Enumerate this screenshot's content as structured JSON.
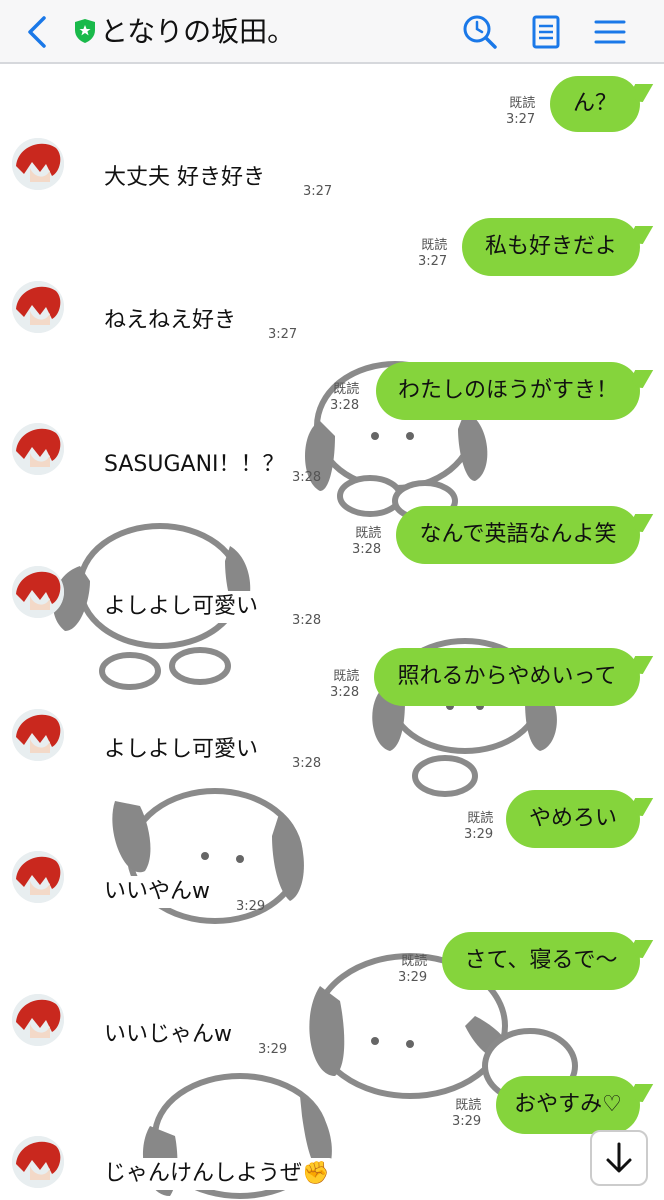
{
  "header": {
    "title": "となりの坂田。",
    "icons": [
      "back-icon",
      "shield-icon",
      "search-icon",
      "notes-icon",
      "menu-icon"
    ],
    "accent_color": "#1a78e8",
    "shield_color": "#19b94a"
  },
  "chat": {
    "bubble_color": "#85d43c",
    "messages": [
      {
        "side": "out",
        "text": "ん？",
        "read": "既読",
        "time": "3:27"
      },
      {
        "side": "in",
        "text": "大丈夫 好き好き",
        "time": "3:27"
      },
      {
        "side": "out",
        "text": "私も好きだよ",
        "read": "既読",
        "time": "3:27"
      },
      {
        "side": "in",
        "text": "ねえねえ好き",
        "time": "3:27"
      },
      {
        "side": "out",
        "text": "わたしのほうがすき！",
        "read": "既読",
        "time": "3:28"
      },
      {
        "side": "in",
        "text": "SASUGANI！！？",
        "time": "3:28"
      },
      {
        "side": "out",
        "text": "なんで英語なんよ笑",
        "read": "既読",
        "time": "3:28"
      },
      {
        "side": "in",
        "text": "よしよし可愛い",
        "time": "3:28"
      },
      {
        "side": "out",
        "text": "照れるからやめいって",
        "read": "既読",
        "time": "3:28"
      },
      {
        "side": "in",
        "text": "よしよし可愛い",
        "time": "3:28"
      },
      {
        "side": "out",
        "text": "やめろい",
        "read": "既読",
        "time": "3:29"
      },
      {
        "side": "in",
        "text": "いいやんw",
        "time": "3:29"
      },
      {
        "side": "out",
        "text": "さて、寝るで〜",
        "read": "既読",
        "time": "3:29"
      },
      {
        "side": "in",
        "text": "いいじゃんw",
        "time": "3:29"
      },
      {
        "side": "out",
        "text": "おやすみ♡",
        "read": "既読",
        "time": "3:29"
      },
      {
        "side": "in",
        "text": "じゃんけんしようぜ✊"
      }
    ]
  },
  "scroll_button": {
    "icon": "arrow-down-icon"
  }
}
